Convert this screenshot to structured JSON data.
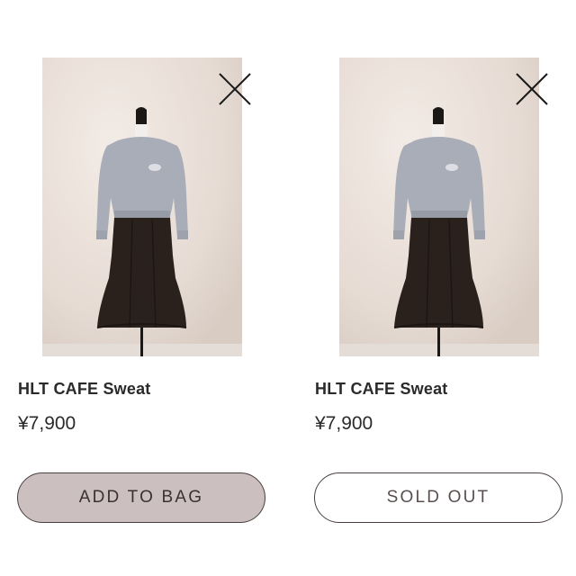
{
  "products": [
    {
      "name": "HLT CAFE Sweat",
      "price": "¥7,900",
      "button_label": "ADD TO BAG",
      "image_icon": "product-photo",
      "remove_icon": "close-icon"
    },
    {
      "name": "HLT CAFE Sweat",
      "price": "¥7,900",
      "button_label": "SOLD OUT",
      "image_icon": "product-photo",
      "remove_icon": "close-icon"
    }
  ],
  "colors": {
    "add_button_bg": "#cbbfbf",
    "border": "#4a4040",
    "text": "#2a2a2a",
    "photo_background": "#ece2dc"
  }
}
